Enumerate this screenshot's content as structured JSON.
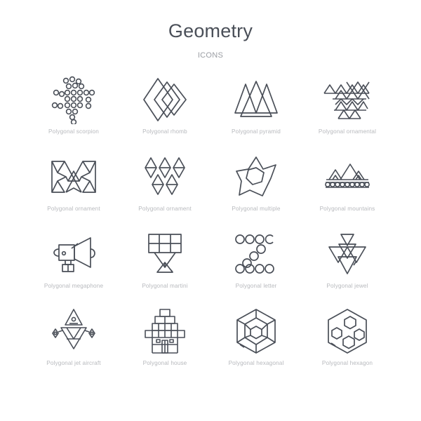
{
  "header": {
    "title": "geometry",
    "subtitle": "icons"
  },
  "colors": {
    "icon_stroke": "#4a4f58",
    "title": "#4a4f58",
    "subtitle": "#9a9da3",
    "label": "#b7b9bd",
    "background": "#ffffff"
  },
  "grid": {
    "columns": 4,
    "rows": 4,
    "count": 16
  },
  "icons": [
    {
      "label": "Polygonal scorpion",
      "icon_name": "polygonal-scorpion-icon"
    },
    {
      "label": "Polygonal rhomb",
      "icon_name": "polygonal-rhomb-icon"
    },
    {
      "label": "Polygonal pyramid",
      "icon_name": "polygonal-pyramid-icon"
    },
    {
      "label": "Polygonal ornamental",
      "icon_name": "polygonal-ornamental-icon"
    },
    {
      "label": "Polygonal ornament",
      "icon_name": "polygonal-ornament-icon"
    },
    {
      "label": "Polygonal ornament",
      "icon_name": "polygonal-ornament-diamonds-icon"
    },
    {
      "label": "Polygonal multiple",
      "icon_name": "polygonal-multiple-star-icon"
    },
    {
      "label": "Polygonal mountains",
      "icon_name": "polygonal-mountains-icon"
    },
    {
      "label": "Polygonal megaphone",
      "icon_name": "polygonal-megaphone-icon"
    },
    {
      "label": "Polygonal martini",
      "icon_name": "polygonal-martini-icon"
    },
    {
      "label": "Polygonal letter",
      "icon_name": "polygonal-letter-z-icon"
    },
    {
      "label": "Polygonal jewel",
      "icon_name": "polygonal-jewel-icon"
    },
    {
      "label": "Polygonal jet aircraft",
      "icon_name": "polygonal-jet-aircraft-icon"
    },
    {
      "label": "Polygonal house",
      "icon_name": "polygonal-house-icon"
    },
    {
      "label": "Polygonal hexagonal",
      "icon_name": "polygonal-hexagonal-icon"
    },
    {
      "label": "Polygonal hexagon",
      "icon_name": "polygonal-hexagon-icon"
    }
  ]
}
